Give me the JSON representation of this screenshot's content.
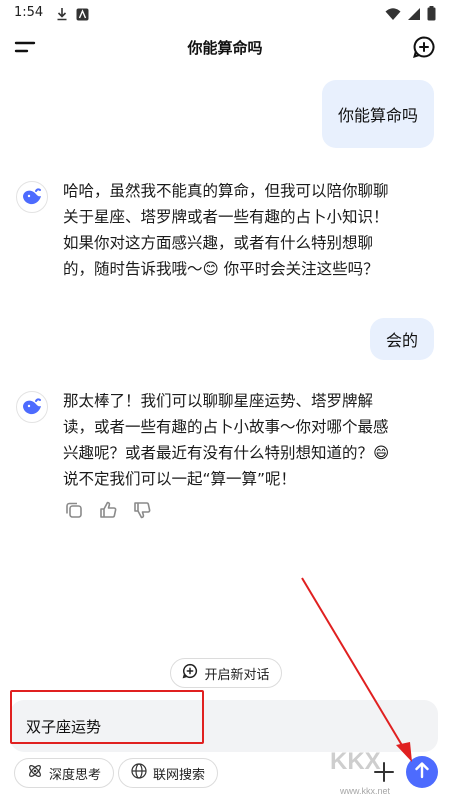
{
  "status_bar": {
    "time": "1:54"
  },
  "header": {
    "title": "你能算命吗"
  },
  "messages": [
    {
      "role": "user",
      "text": "你能算命吗"
    },
    {
      "role": "assistant",
      "lines": [
        "哈哈，虽然我不能真的算命，但我可以陪你聊聊",
        "关于星座、塔罗牌或者一些有趣的占卜小知识！",
        "如果你对这方面感兴趣，或者有什么特别想聊",
        "的，随时告诉我哦～😊 你平时会关注这些吗？"
      ]
    },
    {
      "role": "user",
      "text": "会的"
    },
    {
      "role": "assistant",
      "lines": [
        "那太棒了！我们可以聊聊星座运势、塔罗牌解",
        "读，或者一些有趣的占卜小故事～你对哪个最感",
        "兴趣呢？或者最近有没有什么特别想知道的？😄",
        "说不定我们可以一起“算一算”呢！"
      ]
    }
  ],
  "new_topic": {
    "label": "开启新对话"
  },
  "input": {
    "value": "双子座运势"
  },
  "options": {
    "deep_think": "深度思考",
    "web_search": "联网搜索"
  },
  "watermark": {
    "brand": "KKX",
    "url": "www.kkx.net"
  },
  "colors": {
    "accent": "#4d6bfe",
    "user_bubble": "#e8f0fd",
    "annotation": "#e02020"
  }
}
